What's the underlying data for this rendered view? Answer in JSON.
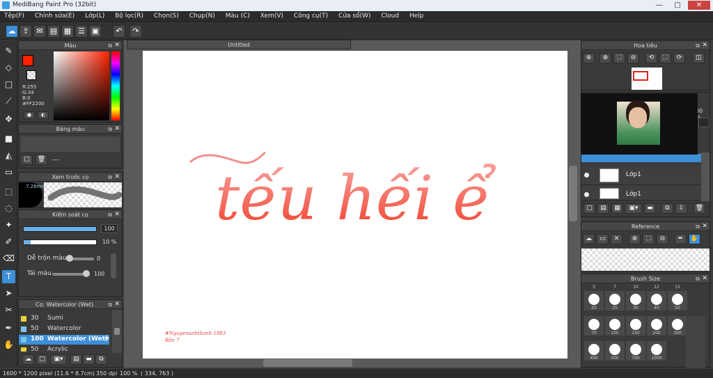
{
  "window": {
    "title": "MediBang Paint Pro (32bit)",
    "min": "—",
    "max": "□",
    "close": "✕"
  },
  "menu": [
    "Tệp(F)",
    "Chỉnh sửa(E)",
    "Lớp(L)",
    "Bộ lọc(R)",
    "Chọn(S)",
    "Chụp(N)",
    "Màu (C)",
    "Xem(V)",
    "Công cụ(T)",
    "Cửa sổ(W)",
    "Cloud",
    "Help"
  ],
  "color_panel": {
    "title": "Màu",
    "r": "R:255",
    "g": "G:34",
    "b": "B:0",
    "hex": "#FF2200",
    "current_color": "#ff2200"
  },
  "palette_panel": {
    "title": "Bảng màu",
    "value": "---"
  },
  "brush_preview": {
    "title": "Xem trước cọ",
    "size": "7.26mm"
  },
  "brush_control": {
    "title": "Kiểm soát cọ",
    "size_value": "100",
    "opacity_value": "10 %",
    "opacity_fraction": 0.1,
    "size_fraction": 1.0,
    "blend_label": "Dễ trộn màu",
    "blend_value": "0",
    "resample_label": "Tái màu",
    "resample_value": "100"
  },
  "brush_list": {
    "title": "Cọ: Watercolor (Wet)",
    "items": [
      {
        "size": "30",
        "name": "Sumi",
        "color": "#e8d23a"
      },
      {
        "size": "50",
        "name": "Watercolor",
        "color": "#7cc6ea"
      },
      {
        "size": "100",
        "name": "Watercolor (Wet)",
        "color": "#7cc6ea",
        "selected": true
      },
      {
        "size": "50",
        "name": "Acrylic",
        "color": "#e8d23a"
      }
    ]
  },
  "document": {
    "tab": "Untitled",
    "art_text": "tếu hếi ể",
    "signature_line1": "#Nguyenanhthanh 1983",
    "signature_line2": "Bản 7"
  },
  "navigator": {
    "title": "Hoa tiêu"
  },
  "layers": {
    "zoom_label": "00 %",
    "items": [
      {
        "name": "Lớp1"
      },
      {
        "name": "Lớp1"
      }
    ]
  },
  "reference": {
    "title": "Reference"
  },
  "brush_size": {
    "title": "Brush Size",
    "top_labels": [
      "5",
      "7",
      "10",
      "12",
      "15"
    ],
    "rows": [
      [
        "20",
        "25",
        "30",
        "40",
        "50"
      ],
      [
        "70",
        "100",
        "150",
        "200",
        "300"
      ],
      [
        "400",
        "500",
        "700",
        "1000"
      ]
    ]
  },
  "status": {
    "dims": "1600 * 1200 pixel",
    "cm": "(11.6 * 8.7cm)",
    "dpi": "350 dpi",
    "zoom": "100 %",
    "coords": "( 334, 763 )"
  }
}
